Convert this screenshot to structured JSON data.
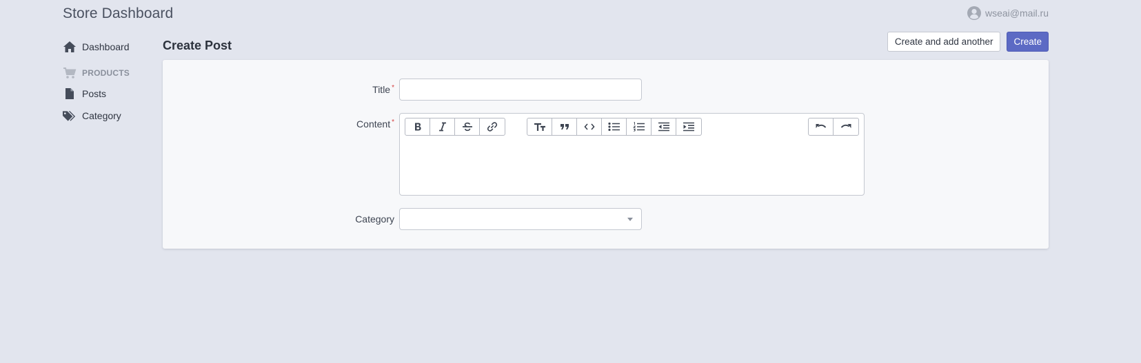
{
  "app": {
    "title": "Store Dashboard"
  },
  "user": {
    "email": "wseai@mail.ru"
  },
  "sidebar": {
    "items": [
      {
        "label": "Dashboard",
        "icon": "home-icon"
      }
    ],
    "group": {
      "label": "PRODUCTS",
      "icon": "cart-icon"
    },
    "group_items": [
      {
        "label": "Posts",
        "icon": "file-icon"
      },
      {
        "label": "Category",
        "icon": "tags-icon"
      }
    ]
  },
  "page": {
    "title": "Create Post"
  },
  "actions": {
    "create_another_label": "Create and add another",
    "create_label": "Create"
  },
  "form": {
    "title_label": "Title",
    "title_value": "",
    "content_label": "Content",
    "category_label": "Category",
    "category_value": "",
    "required_mark": "*"
  },
  "toolbar": {
    "groups": [
      [
        "bold-icon",
        "italic-icon",
        "strikethrough-icon",
        "link-icon"
      ],
      [
        "heading-icon",
        "quote-icon",
        "code-icon",
        "bullet-list-icon",
        "numbered-list-icon",
        "outdent-icon",
        "indent-icon"
      ],
      [
        "undo-icon",
        "redo-icon"
      ]
    ]
  },
  "colors": {
    "background": "#e2e5ee",
    "card": "#f7f8fa",
    "primary": "#5c6ac4",
    "required": "#d43f3f"
  }
}
